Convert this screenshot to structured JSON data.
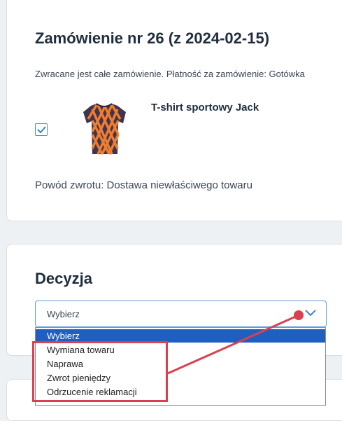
{
  "order": {
    "title": "Zamówienie nr 26 (z 2024-02-15)",
    "info": "Zwracane jest całe zamówienie. Płatność za zamówienie: Gotówka",
    "item": {
      "checked": true,
      "name": "T-shirt sportowy Jack",
      "image_icon": "tshirt-icon"
    },
    "reason": "Powód zwrotu: Dostawa niewłaściwego towaru"
  },
  "decision": {
    "title": "Decyzja",
    "select": {
      "value": "Wybierz",
      "options": [
        "Wybierz",
        "Wymiana towaru",
        "Naprawa",
        "Zwrot pieniędzy",
        "Odrzucenie reklamacji"
      ],
      "selected_index": 0
    }
  },
  "colors": {
    "accent": "#5a9fd6",
    "highlight": "#1e5fbf",
    "annotation": "#d94050"
  }
}
